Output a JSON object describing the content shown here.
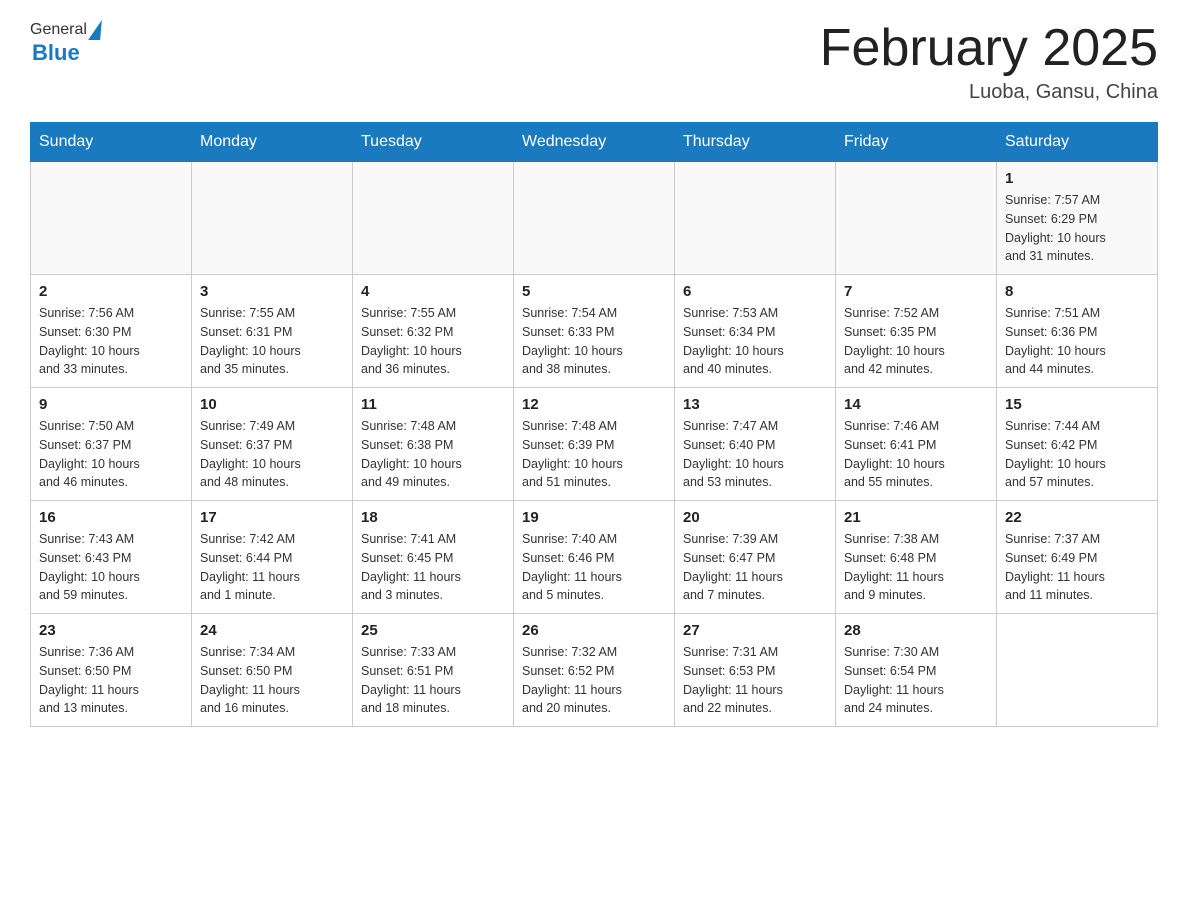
{
  "header": {
    "logo_general": "General",
    "logo_blue": "Blue",
    "month_title": "February 2025",
    "location": "Luoba, Gansu, China"
  },
  "weekdays": [
    "Sunday",
    "Monday",
    "Tuesday",
    "Wednesday",
    "Thursday",
    "Friday",
    "Saturday"
  ],
  "weeks": [
    [
      {
        "day": "",
        "info": ""
      },
      {
        "day": "",
        "info": ""
      },
      {
        "day": "",
        "info": ""
      },
      {
        "day": "",
        "info": ""
      },
      {
        "day": "",
        "info": ""
      },
      {
        "day": "",
        "info": ""
      },
      {
        "day": "1",
        "info": "Sunrise: 7:57 AM\nSunset: 6:29 PM\nDaylight: 10 hours\nand 31 minutes."
      }
    ],
    [
      {
        "day": "2",
        "info": "Sunrise: 7:56 AM\nSunset: 6:30 PM\nDaylight: 10 hours\nand 33 minutes."
      },
      {
        "day": "3",
        "info": "Sunrise: 7:55 AM\nSunset: 6:31 PM\nDaylight: 10 hours\nand 35 minutes."
      },
      {
        "day": "4",
        "info": "Sunrise: 7:55 AM\nSunset: 6:32 PM\nDaylight: 10 hours\nand 36 minutes."
      },
      {
        "day": "5",
        "info": "Sunrise: 7:54 AM\nSunset: 6:33 PM\nDaylight: 10 hours\nand 38 minutes."
      },
      {
        "day": "6",
        "info": "Sunrise: 7:53 AM\nSunset: 6:34 PM\nDaylight: 10 hours\nand 40 minutes."
      },
      {
        "day": "7",
        "info": "Sunrise: 7:52 AM\nSunset: 6:35 PM\nDaylight: 10 hours\nand 42 minutes."
      },
      {
        "day": "8",
        "info": "Sunrise: 7:51 AM\nSunset: 6:36 PM\nDaylight: 10 hours\nand 44 minutes."
      }
    ],
    [
      {
        "day": "9",
        "info": "Sunrise: 7:50 AM\nSunset: 6:37 PM\nDaylight: 10 hours\nand 46 minutes."
      },
      {
        "day": "10",
        "info": "Sunrise: 7:49 AM\nSunset: 6:37 PM\nDaylight: 10 hours\nand 48 minutes."
      },
      {
        "day": "11",
        "info": "Sunrise: 7:48 AM\nSunset: 6:38 PM\nDaylight: 10 hours\nand 49 minutes."
      },
      {
        "day": "12",
        "info": "Sunrise: 7:48 AM\nSunset: 6:39 PM\nDaylight: 10 hours\nand 51 minutes."
      },
      {
        "day": "13",
        "info": "Sunrise: 7:47 AM\nSunset: 6:40 PM\nDaylight: 10 hours\nand 53 minutes."
      },
      {
        "day": "14",
        "info": "Sunrise: 7:46 AM\nSunset: 6:41 PM\nDaylight: 10 hours\nand 55 minutes."
      },
      {
        "day": "15",
        "info": "Sunrise: 7:44 AM\nSunset: 6:42 PM\nDaylight: 10 hours\nand 57 minutes."
      }
    ],
    [
      {
        "day": "16",
        "info": "Sunrise: 7:43 AM\nSunset: 6:43 PM\nDaylight: 10 hours\nand 59 minutes."
      },
      {
        "day": "17",
        "info": "Sunrise: 7:42 AM\nSunset: 6:44 PM\nDaylight: 11 hours\nand 1 minute."
      },
      {
        "day": "18",
        "info": "Sunrise: 7:41 AM\nSunset: 6:45 PM\nDaylight: 11 hours\nand 3 minutes."
      },
      {
        "day": "19",
        "info": "Sunrise: 7:40 AM\nSunset: 6:46 PM\nDaylight: 11 hours\nand 5 minutes."
      },
      {
        "day": "20",
        "info": "Sunrise: 7:39 AM\nSunset: 6:47 PM\nDaylight: 11 hours\nand 7 minutes."
      },
      {
        "day": "21",
        "info": "Sunrise: 7:38 AM\nSunset: 6:48 PM\nDaylight: 11 hours\nand 9 minutes."
      },
      {
        "day": "22",
        "info": "Sunrise: 7:37 AM\nSunset: 6:49 PM\nDaylight: 11 hours\nand 11 minutes."
      }
    ],
    [
      {
        "day": "23",
        "info": "Sunrise: 7:36 AM\nSunset: 6:50 PM\nDaylight: 11 hours\nand 13 minutes."
      },
      {
        "day": "24",
        "info": "Sunrise: 7:34 AM\nSunset: 6:50 PM\nDaylight: 11 hours\nand 16 minutes."
      },
      {
        "day": "25",
        "info": "Sunrise: 7:33 AM\nSunset: 6:51 PM\nDaylight: 11 hours\nand 18 minutes."
      },
      {
        "day": "26",
        "info": "Sunrise: 7:32 AM\nSunset: 6:52 PM\nDaylight: 11 hours\nand 20 minutes."
      },
      {
        "day": "27",
        "info": "Sunrise: 7:31 AM\nSunset: 6:53 PM\nDaylight: 11 hours\nand 22 minutes."
      },
      {
        "day": "28",
        "info": "Sunrise: 7:30 AM\nSunset: 6:54 PM\nDaylight: 11 hours\nand 24 minutes."
      },
      {
        "day": "",
        "info": ""
      }
    ]
  ]
}
